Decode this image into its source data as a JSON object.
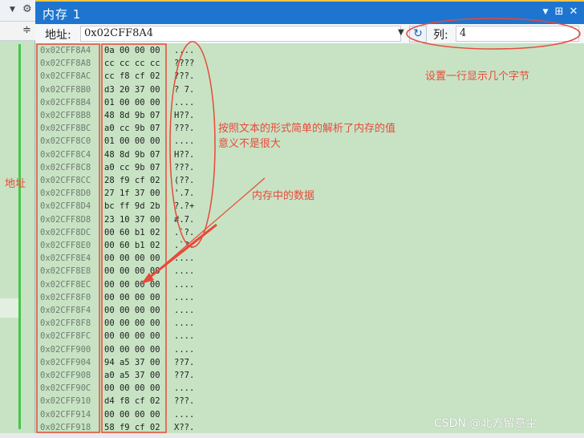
{
  "window": {
    "title": "内存 1",
    "buttons": {
      "dropdown": "▼",
      "pin": "⊞",
      "close": "✕"
    }
  },
  "left_pane": {
    "dropdown_icon": "▼",
    "settings_icon": "⚙",
    "expand_icon": "≑"
  },
  "toolbar": {
    "address_label": "地址:",
    "address_value": "0x02CFF8A4",
    "refresh_icon": "↻",
    "columns_label": "列:",
    "columns_value": "4"
  },
  "memory_rows": [
    {
      "addr": "0x02CFF8A4",
      "hex": "0a 00 00 00",
      "text": "...."
    },
    {
      "addr": "0x02CFF8A8",
      "hex": "cc cc cc cc",
      "text": "????"
    },
    {
      "addr": "0x02CFF8AC",
      "hex": "cc f8 cf 02",
      "text": "???."
    },
    {
      "addr": "0x02CFF8B0",
      "hex": "d3 20 37 00",
      "text": "? 7."
    },
    {
      "addr": "0x02CFF8B4",
      "hex": "01 00 00 00",
      "text": "...."
    },
    {
      "addr": "0x02CFF8B8",
      "hex": "48 8d 9b 07",
      "text": "H??."
    },
    {
      "addr": "0x02CFF8BC",
      "hex": "a0 cc 9b 07",
      "text": "???."
    },
    {
      "addr": "0x02CFF8C0",
      "hex": "01 00 00 00",
      "text": "...."
    },
    {
      "addr": "0x02CFF8C4",
      "hex": "48 8d 9b 07",
      "text": "H??."
    },
    {
      "addr": "0x02CFF8C8",
      "hex": "a0 cc 9b 07",
      "text": "???."
    },
    {
      "addr": "0x02CFF8CC",
      "hex": "28 f9 cf 02",
      "text": "(??."
    },
    {
      "addr": "0x02CFF8D0",
      "hex": "27 1f 37 00",
      "text": "'.7."
    },
    {
      "addr": "0x02CFF8D4",
      "hex": "bc ff 9d 2b",
      "text": "?.?+"
    },
    {
      "addr": "0x02CFF8D8",
      "hex": "23 10 37 00",
      "text": "#.7."
    },
    {
      "addr": "0x02CFF8DC",
      "hex": "00 60 b1 02",
      "text": ".`?."
    },
    {
      "addr": "0x02CFF8E0",
      "hex": "00 60 b1 02",
      "text": ".`?."
    },
    {
      "addr": "0x02CFF8E4",
      "hex": "00 00 00 00",
      "text": "...."
    },
    {
      "addr": "0x02CFF8E8",
      "hex": "00 00 00 00",
      "text": "...."
    },
    {
      "addr": "0x02CFF8EC",
      "hex": "00 00 00 00",
      "text": "...."
    },
    {
      "addr": "0x02CFF8F0",
      "hex": "00 00 00 00",
      "text": "...."
    },
    {
      "addr": "0x02CFF8F4",
      "hex": "00 00 00 00",
      "text": "...."
    },
    {
      "addr": "0x02CFF8F8",
      "hex": "00 00 00 00",
      "text": "...."
    },
    {
      "addr": "0x02CFF8FC",
      "hex": "00 00 00 00",
      "text": "...."
    },
    {
      "addr": "0x02CFF900",
      "hex": "00 00 00 00",
      "text": "...."
    },
    {
      "addr": "0x02CFF904",
      "hex": "94 a5 37 00",
      "text": "??7."
    },
    {
      "addr": "0x02CFF908",
      "hex": "a0 a5 37 00",
      "text": "??7."
    },
    {
      "addr": "0x02CFF90C",
      "hex": "00 00 00 00",
      "text": "...."
    },
    {
      "addr": "0x02CFF910",
      "hex": "d4 f8 cf 02",
      "text": "???."
    },
    {
      "addr": "0x02CFF914",
      "hex": "00 00 00 00",
      "text": "...."
    },
    {
      "addr": "0x02CFF918",
      "hex": "58 f9 cf 02",
      "text": "X??."
    }
  ],
  "annotations": {
    "columns_note": "设置一行显示几个字节",
    "text_note_line1": "按照文本的形式简单的解析了内存的值",
    "text_note_line2": "意义不是很大",
    "data_note": "内存中的数据",
    "address_note": "地址"
  },
  "watermark": "CSDN @北方留意尘",
  "colors": {
    "annotation": "#e8493a",
    "title_bar": "#1e75d0",
    "background": "#c7e3c4"
  }
}
